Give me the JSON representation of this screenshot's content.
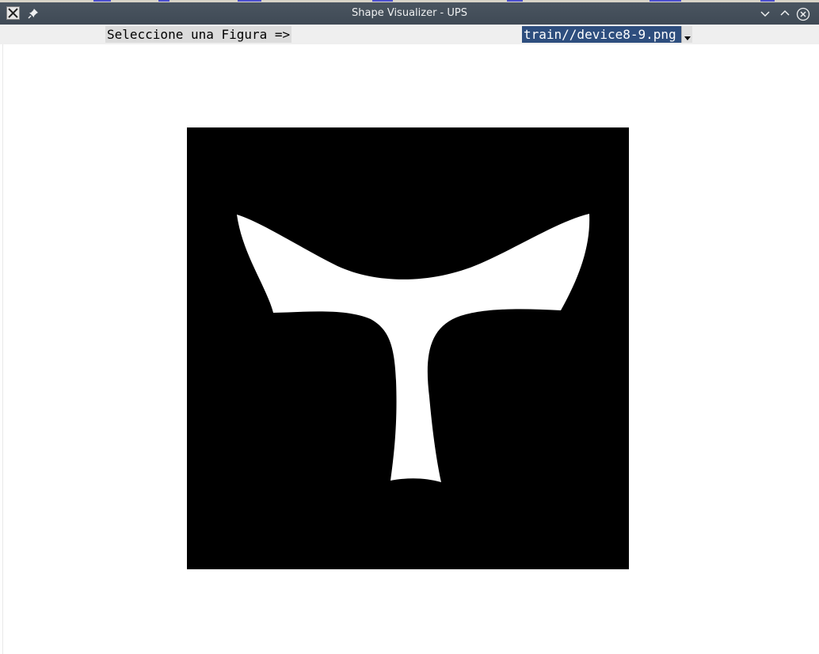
{
  "window": {
    "title": "Shape Visualizer - UPS",
    "icons": {
      "app": "x11-app-icon",
      "pin": "pin-icon",
      "minimize": "chevron-down-icon",
      "maximize": "chevron-up-icon",
      "close": "close-circle-icon"
    }
  },
  "toolbar": {
    "prompt_label": "Seleccione una Figura =>",
    "figure_select": {
      "selected": "train//device8-9.png"
    }
  },
  "canvas": {
    "background": "#000000",
    "shape_color": "#ffffff"
  },
  "colors": {
    "titlebar": "#45505b",
    "select_highlight": "#2e4e7e"
  }
}
